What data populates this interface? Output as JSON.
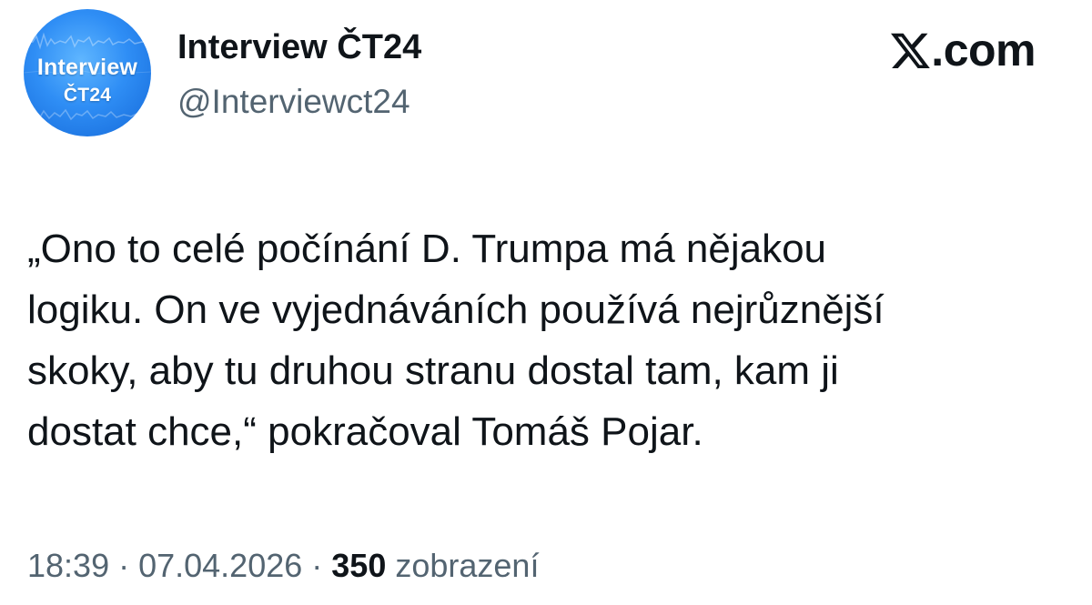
{
  "avatar": {
    "line1": "Interview",
    "line2": "ČT24",
    "bg_color": "#2f8ef5",
    "icon": "interview-ct24-avatar"
  },
  "author": {
    "display_name": "Interview ČT24",
    "handle": "@Interviewct24"
  },
  "brand": {
    "icon": "x-logo-icon",
    "suffix": ".com"
  },
  "tweet": {
    "text": "„Ono to celé počínání D. Trumpa má nějakou\nlogiku. On ve vyjednáváních používá nejrůznější\nskoky, aby tu druhou stranu dostal tam, kam ji\ndostat chce,“ pokračoval Tomáš Pojar."
  },
  "meta": {
    "time": "18:39",
    "separator": " · ",
    "date": "07.04.2026",
    "views_count": "350",
    "views_label": " zobrazení"
  },
  "colors": {
    "primary_text": "#0f1419",
    "secondary_text": "#536471",
    "background": "#ffffff"
  }
}
